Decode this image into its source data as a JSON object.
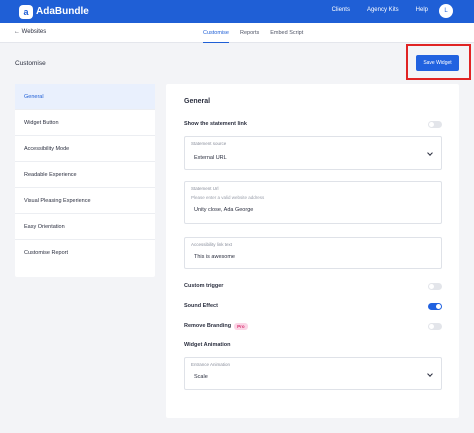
{
  "header": {
    "logo_mark": "a",
    "brand": "AdaBundle",
    "nav": [
      "Clients",
      "Agency Kits",
      "Help"
    ],
    "avatar_initial": "L"
  },
  "subnav": {
    "back_label": "← Websites",
    "tabs": [
      {
        "label": "Customise",
        "active": true
      },
      {
        "label": "Reports",
        "active": false
      },
      {
        "label": "Embed Script",
        "active": false
      }
    ]
  },
  "page": {
    "title": "Customise",
    "save_label": "Save Widget"
  },
  "sidebar": {
    "items": [
      {
        "label": "General",
        "active": true
      },
      {
        "label": "Widget Button",
        "active": false
      },
      {
        "label": "Accessibility Mode",
        "active": false
      },
      {
        "label": "Readable Experience",
        "active": false
      },
      {
        "label": "Visual Pleasing Experience",
        "active": false
      },
      {
        "label": "Easy Orientation",
        "active": false
      },
      {
        "label": "Customise Report",
        "active": false
      }
    ]
  },
  "general": {
    "title": "General",
    "show_statement_link": {
      "label": "Show the statement link",
      "on": false
    },
    "statement_source": {
      "label": "Statement source",
      "value": "External URL"
    },
    "statement_url": {
      "label": "Statement Url",
      "placeholder": "Please enter a valid website address",
      "value": "Unity close, Ada George"
    },
    "accessibility_link_text": {
      "label": "Accessibility link text",
      "value": "This is awesome"
    },
    "custom_trigger": {
      "label": "Custom trigger",
      "on": false
    },
    "sound_effect": {
      "label": "Sound Effect",
      "on": true
    },
    "remove_branding": {
      "label": "Remove Branding",
      "badge": "Pro",
      "on": false
    },
    "widget_animation": {
      "label": "Widget Animation"
    },
    "entrance_animation": {
      "label": "Entrance Animation",
      "value": "Scale"
    }
  },
  "colors": {
    "primary": "#1f5fd6",
    "highlight": "#e02424",
    "pro_badge": "#d6306e"
  }
}
